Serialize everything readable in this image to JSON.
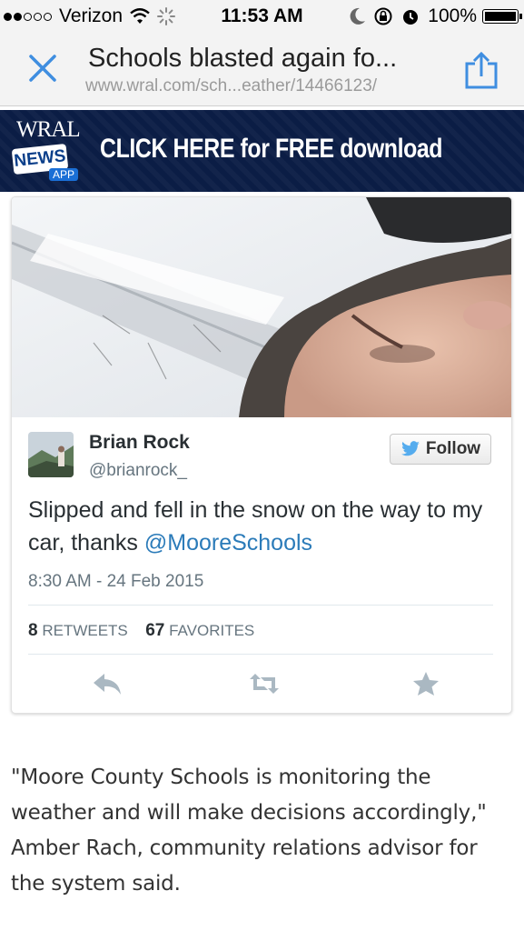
{
  "status_bar": {
    "carrier": "Verizon",
    "time": "11:53 AM",
    "battery": "100%",
    "signal_bars_filled": 2,
    "signal_bars_total": 5
  },
  "browser": {
    "page_title": "Schools blasted again fo...",
    "url": "www.wral.com/sch...eather/14466123/"
  },
  "banner": {
    "logo_top": "WRAL",
    "logo_mid": "NEWS",
    "logo_badge": "APP",
    "text": "CLICK HERE for FREE download"
  },
  "tweet": {
    "author_name": "Brian Rock",
    "author_handle": "@brianrock_",
    "follow_label": "Follow",
    "text_before": "Slipped and fell in the snow on the way to my car, thanks ",
    "mention": "@MooreSchools",
    "timestamp": "8:30 AM - 24 Feb 2015",
    "retweets_count": "8",
    "retweets_label": "RETWEETS",
    "favorites_count": "67",
    "favorites_label": "FAVORITES"
  },
  "article": {
    "paragraph": "\"Moore County Schools is monitoring the weather and will make decisions accordingly,\" Amber Rach, community relations advisor for the system said."
  },
  "colors": {
    "banner_bg": "#0b1d45",
    "link": "#2b7bb9",
    "ios_blue": "#3f8ee0",
    "twitter_blue": "#55acee"
  }
}
